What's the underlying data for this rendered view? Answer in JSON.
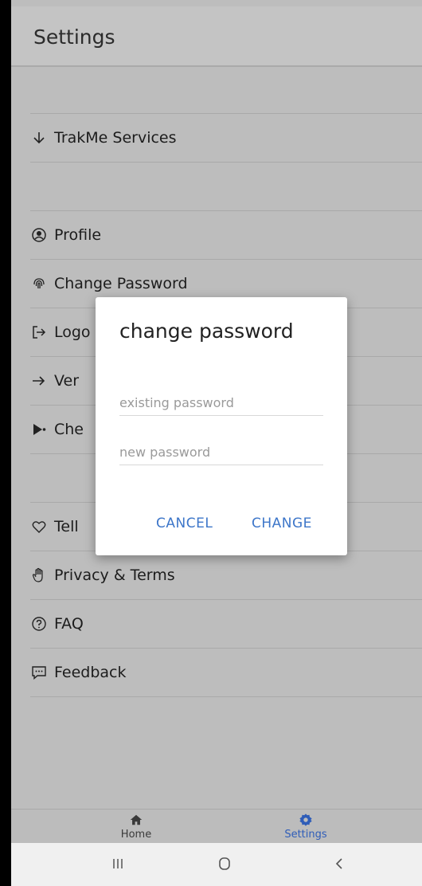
{
  "header": {
    "title": "Settings"
  },
  "settings": {
    "items": [
      {
        "icon": "arrow-down-icon",
        "label": "TrakMe Services"
      },
      {
        "icon": "user-circle-icon",
        "label": "Profile"
      },
      {
        "icon": "fingerprint-icon",
        "label": "Change Password"
      },
      {
        "icon": "logout-icon",
        "label": "Logout"
      },
      {
        "icon": "arrow-right-icon",
        "label": "Version"
      },
      {
        "icon": "share-icon",
        "label": "Check"
      },
      {
        "icon": "heart-icon",
        "label": "Tell a friend"
      },
      {
        "icon": "hand-icon",
        "label": "Privacy & Terms"
      },
      {
        "icon": "question-circle-icon",
        "label": "FAQ"
      },
      {
        "icon": "chat-bubble-icon",
        "label": "Feedback"
      }
    ],
    "obscured_labels": {
      "logout": "Logo",
      "version": "Ver",
      "check": "Che",
      "tell": "Tell"
    }
  },
  "dialog": {
    "title": "change password",
    "existing_placeholder": "existing password",
    "new_placeholder": "new password",
    "cancel_label": "CANCEL",
    "change_label": "CHANGE"
  },
  "bottom_nav": {
    "home_label": "Home",
    "settings_label": "Settings",
    "active": "Settings"
  },
  "colors": {
    "accent": "#3d76c9",
    "nav_active": "#2f5db8"
  }
}
